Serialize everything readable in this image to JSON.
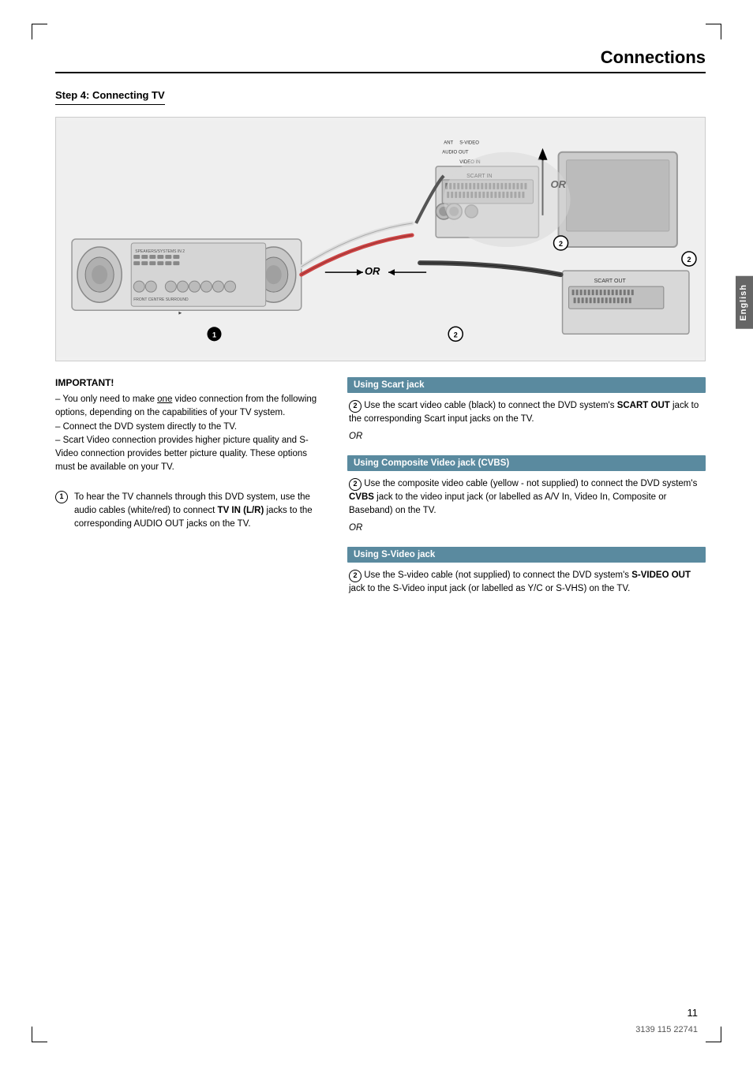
{
  "page": {
    "title": "Connections",
    "step_heading": "Step 4:  Connecting TV",
    "language_tab": "English",
    "page_number": "11",
    "doc_number": "3139 115 22741"
  },
  "diagram": {
    "or_label_1": "OR",
    "or_label_2": "OR",
    "circle_1": "1",
    "circle_2": "2"
  },
  "important": {
    "title": "IMPORTANT!",
    "lines": [
      "– You only need to make one video connection from the following options, depending on the capabilities of your TV system.",
      "– Connect the DVD system directly to the TV.",
      "– Scart Video connection provides higher picture quality and S-Video connection provides better picture quality. These options must be available on your TV."
    ]
  },
  "step1": {
    "circle": "1",
    "text_parts": [
      "To hear the TV channels through this DVD system, use the audio cables (white/red) to connect ",
      "TV IN (L/R)",
      " jacks to the corresponding AUDIO OUT jacks on the TV."
    ]
  },
  "using_scart": {
    "heading": "Using Scart jack",
    "circle": "2",
    "text": "Use the scart video cable (black) to connect the DVD system's ",
    "bold1": "SCART OUT",
    "text2": " jack to the corresponding Scart input jacks on the TV.",
    "or": "OR"
  },
  "using_composite": {
    "heading": "Using Composite Video jack (CVBS)",
    "circle": "2",
    "text": "Use the composite video cable (yellow - not supplied) to connect the DVD system's ",
    "bold1": "CVBS",
    "text2": " jack to the video input jack (or labelled as A/V In, Video In, Composite or Baseband) on the TV.",
    "or": "OR"
  },
  "using_svideo": {
    "heading": "Using S-Video jack",
    "circle": "2",
    "text": "Use the S-video cable (not supplied) to connect the DVD system's ",
    "bold1": "S-VIDEO OUT",
    "text2": " jack to the S-Video input jack (or labelled as Y/C or S-VHS) on the TV."
  }
}
